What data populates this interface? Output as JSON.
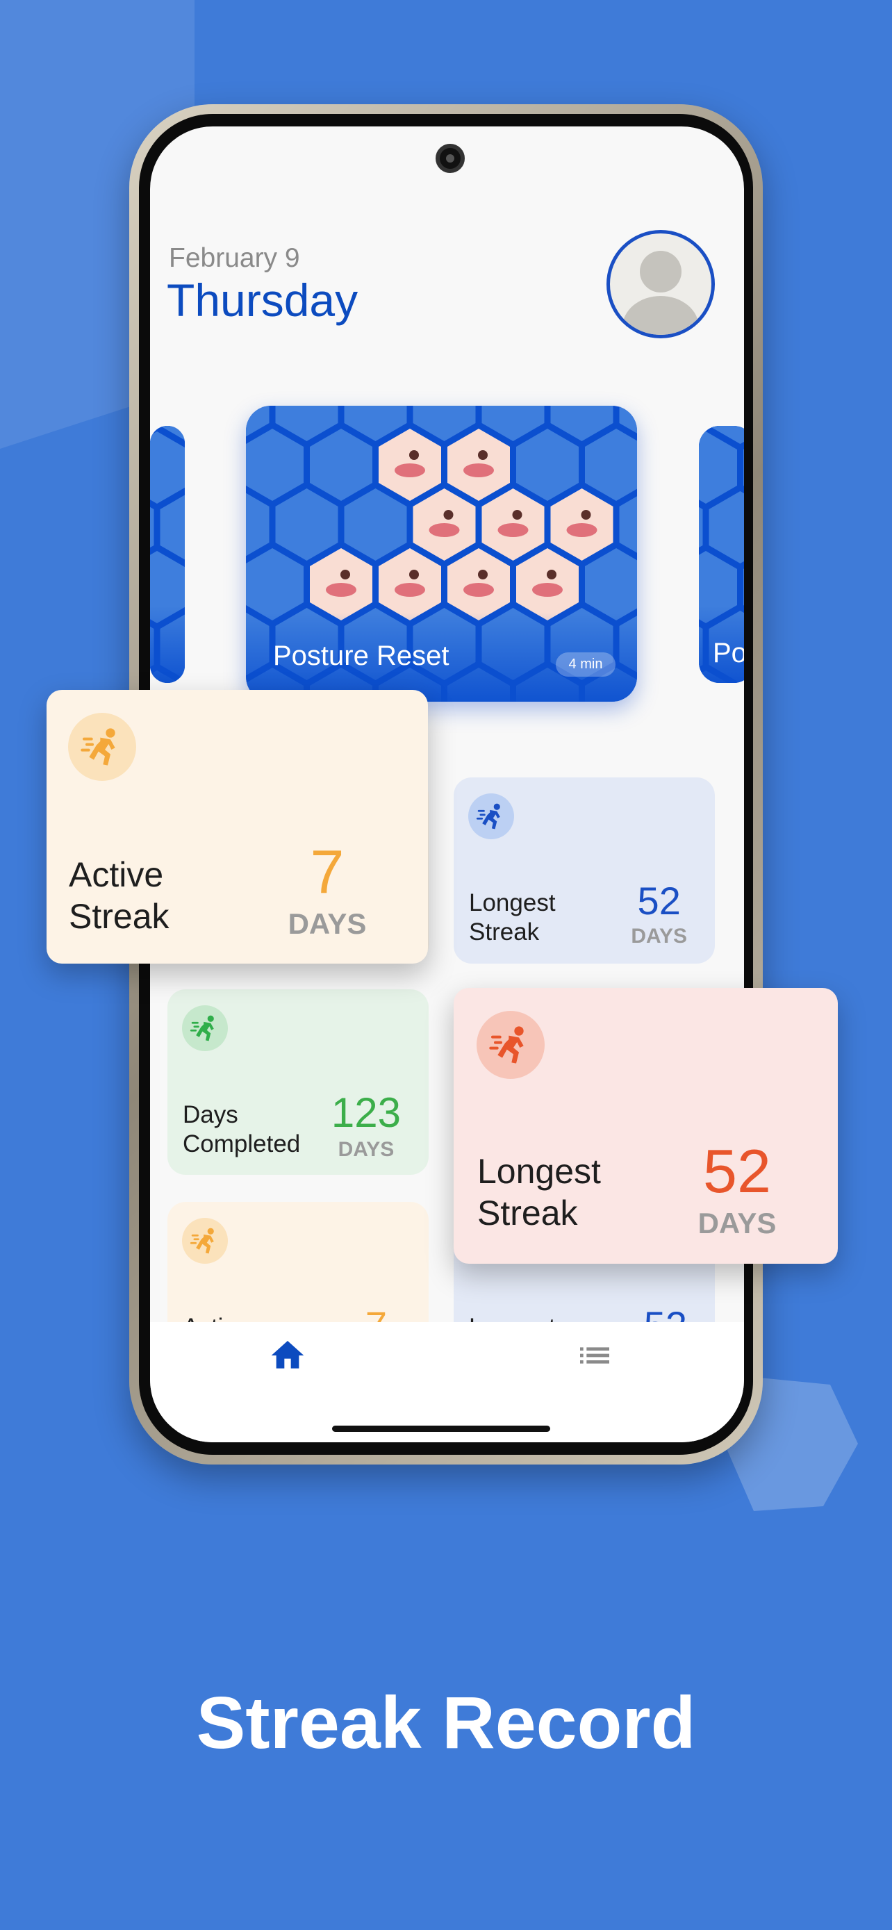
{
  "header": {
    "date": "February 9",
    "weekday": "Thursday"
  },
  "workout_cards": [
    {
      "title": "Posture Reset",
      "duration": "4 min"
    },
    {
      "title": "Po"
    }
  ],
  "stats": {
    "active_streak": {
      "label_line1": "Active",
      "label_line2": "Streak",
      "value": "7",
      "unit": "DAYS",
      "color": "#f4a83a"
    },
    "longest_streak": {
      "label_line1": "Longest",
      "label_line2": "Streak",
      "value": "52",
      "unit": "DAYS",
      "color": "#1a4fc4"
    },
    "days_completed": {
      "label_line1": "Days",
      "label_line2": "Completed",
      "value": "123",
      "unit": "DAYS",
      "color": "#3cae4a"
    },
    "longest_streak_highlight": {
      "label_line1": "Longest",
      "label_line2": "Streak",
      "value": "52",
      "unit": "DAYS",
      "color": "#e8552b"
    }
  },
  "nav": {
    "items": [
      {
        "icon": "home-icon",
        "active": true
      },
      {
        "icon": "list-icon",
        "active": false
      }
    ]
  },
  "caption": "Streak Record",
  "colors": {
    "background": "#3f7bd8",
    "accent": "#0c4bbf"
  }
}
